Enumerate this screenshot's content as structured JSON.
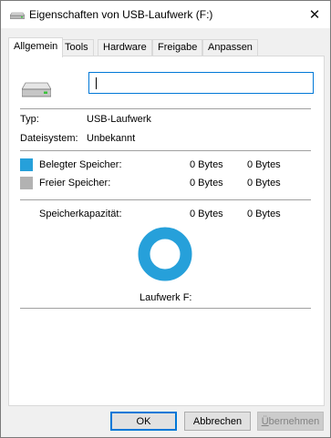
{
  "window": {
    "title": "Eigenschaften von USB-Laufwerk (F:)",
    "close_glyph": "✕",
    "title_icon": "usb-drive-icon"
  },
  "tabs": [
    {
      "label": "Allgemein",
      "active": true
    },
    {
      "label": "Tools"
    },
    {
      "label": "Hardware"
    },
    {
      "label": "Freigabe"
    },
    {
      "label": "Anpassen"
    }
  ],
  "general": {
    "drive_icon": "usb-drive-icon",
    "name_value": "",
    "type_label": "Typ:",
    "type_value": "USB-Laufwerk",
    "fs_label": "Dateisystem:",
    "fs_value": "Unbekannt",
    "used": {
      "label": "Belegter Speicher:",
      "bytes": "0 Bytes",
      "short": "0 Bytes",
      "color": "#26a0da"
    },
    "free": {
      "label": "Freier Speicher:",
      "bytes": "0 Bytes",
      "short": "0 Bytes",
      "color": "#b2b2b2"
    },
    "capacity": {
      "label": "Speicherkapazität:",
      "bytes": "0 Bytes",
      "short": "0 Bytes"
    },
    "drive_label": "Laufwerk F:",
    "donut_color": "#26a0da"
  },
  "buttons": {
    "ok": "OK",
    "cancel": "Abbrechen",
    "apply_prefix": "Ü",
    "apply_rest": "bernehmen"
  }
}
